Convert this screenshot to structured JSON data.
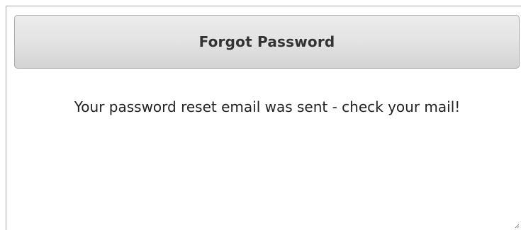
{
  "dialog": {
    "title": "Forgot Password",
    "message": "Your password reset email was sent - check your mail!"
  }
}
